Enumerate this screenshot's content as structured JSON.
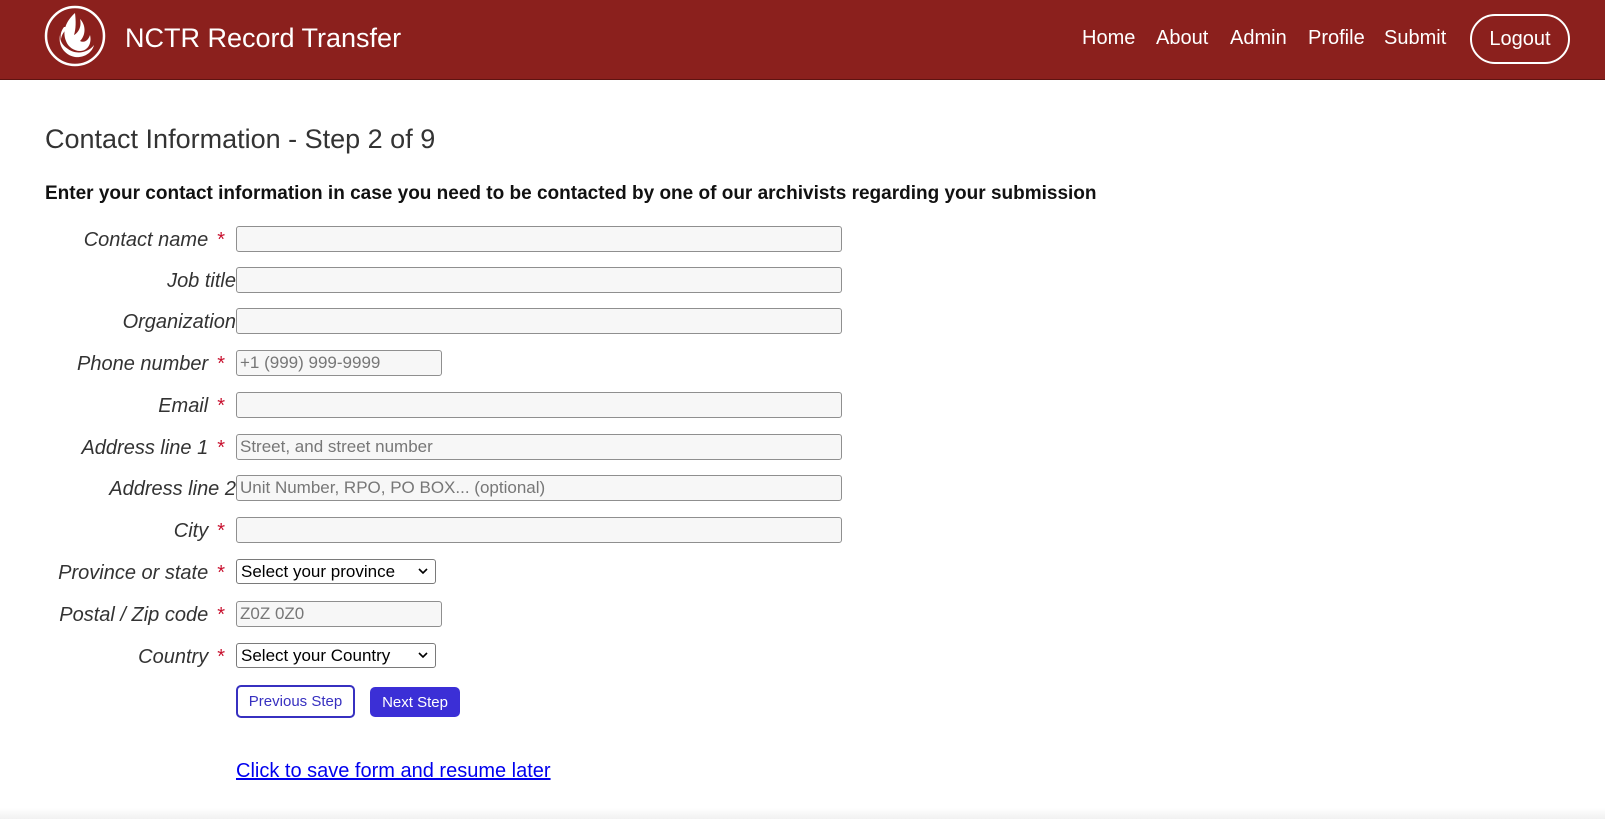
{
  "app": {
    "brand_title": "NCTR Record Transfer",
    "accent_color": "#8b201d",
    "logo_icon": "flame-feather-logo"
  },
  "nav": {
    "items": [
      {
        "label": "Home"
      },
      {
        "label": "About"
      },
      {
        "label": "Admin"
      },
      {
        "label": "Profile"
      },
      {
        "label": "Submit"
      }
    ],
    "logout_label": "Logout"
  },
  "page": {
    "title": "Contact Information - Step 2 of 9",
    "instructions": "Enter your contact information in case you need to be contacted by one of our archivists regarding your submission"
  },
  "form": {
    "contact_name": {
      "label": "Contact name",
      "value": "",
      "placeholder": ""
    },
    "job_title": {
      "label": "Job title",
      "value": "",
      "placeholder": ""
    },
    "organization": {
      "label": "Organization",
      "value": "",
      "placeholder": ""
    },
    "phone_number": {
      "label": "Phone number",
      "value": "",
      "placeholder": "+1 (999) 999-9999"
    },
    "email": {
      "label": "Email",
      "value": "",
      "placeholder": ""
    },
    "address_line_1": {
      "label": "Address line 1",
      "value": "",
      "placeholder": "Street, and street number"
    },
    "address_line_2": {
      "label": "Address line 2",
      "value": "",
      "placeholder": "Unit Number, RPO, PO BOX... (optional)"
    },
    "city": {
      "label": "City",
      "value": "",
      "placeholder": ""
    },
    "province_or_state": {
      "label": "Province or state",
      "selected": "Select your province"
    },
    "postal_code": {
      "label": "Postal / Zip code",
      "value": "",
      "placeholder": "Z0Z 0Z0"
    },
    "country": {
      "label": "Country",
      "selected": "Select your Country"
    },
    "required_marker": "*"
  },
  "actions": {
    "previous_label": "Previous Step",
    "next_label": "Next Step",
    "save_link_label": "Click to save form and resume later"
  }
}
